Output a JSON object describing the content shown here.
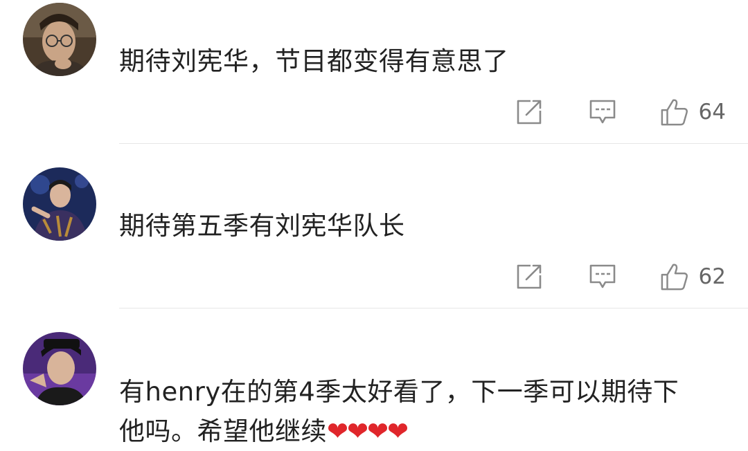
{
  "comments": [
    {
      "text": "期待刘宪华，节目都变得有意思了",
      "likes": "64",
      "avatar_icon": "avatar-man-glasses"
    },
    {
      "text": "期待第五季有刘宪华队长",
      "likes": "62",
      "avatar_icon": "avatar-performer-stage"
    },
    {
      "text_line1": "有henry在的第4季太好看了，下一季可以期待下",
      "text_line2": "他吗。希望他继续",
      "hearts": "❤❤❤❤",
      "avatar_icon": "avatar-man-cap"
    }
  ],
  "icons": {
    "share": "share-icon",
    "reply": "reply-icon",
    "like": "thumbs-up-icon"
  },
  "colors": {
    "icon_gray": "#8a8a8a",
    "text": "#222222",
    "count": "#666666",
    "heart": "#e0262b",
    "divider": "#e6e6e6"
  }
}
